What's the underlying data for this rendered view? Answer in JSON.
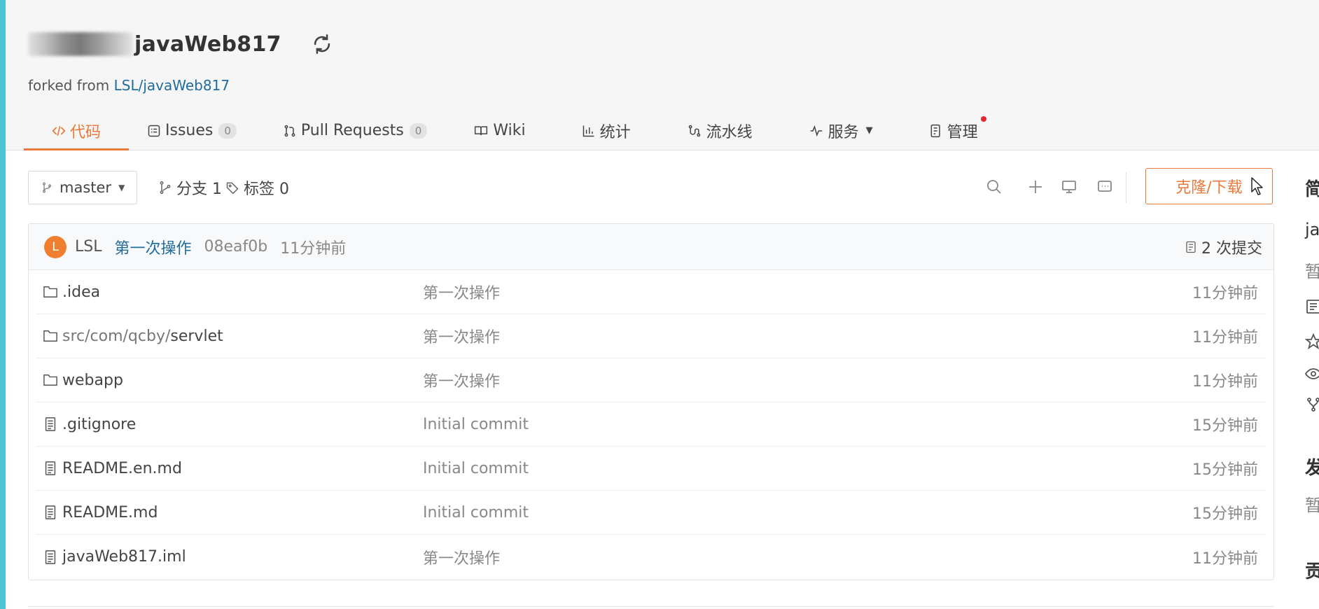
{
  "repo": {
    "name": "javaWeb817",
    "forked_prefix": "forked from ",
    "forked_link": "LSL/javaWeb817"
  },
  "tabs": [
    {
      "label": "代码",
      "icon": "code-icon",
      "active": true
    },
    {
      "label": "Issues",
      "icon": "issues-icon",
      "badge": "0"
    },
    {
      "label": "Pull Requests",
      "icon": "pull-request-icon",
      "badge": "0"
    },
    {
      "label": "Wiki",
      "icon": "wiki-icon"
    },
    {
      "label": "统计",
      "icon": "stats-icon"
    },
    {
      "label": "流水线",
      "icon": "pipeline-icon"
    },
    {
      "label": "服务",
      "icon": "service-icon"
    },
    {
      "label": "管理",
      "icon": "manage-icon"
    }
  ],
  "toolbar": {
    "branch": "master",
    "branches": "分支 1",
    "tags": "标签 0",
    "clone_label": "克隆/下载"
  },
  "last_commit": {
    "avatar_letter": "L",
    "author": "LSL",
    "message": "第一次操作",
    "sha": "08eaf0b",
    "time": "11分钟前",
    "commits_count": "2 次提交"
  },
  "files": [
    {
      "type": "folder",
      "name": ".idea",
      "message": "第一次操作",
      "time": "11分钟前"
    },
    {
      "type": "folder",
      "path": "src/com/qcby/",
      "name": "servlet",
      "message": "第一次操作",
      "time": "11分钟前"
    },
    {
      "type": "folder",
      "name": "webapp",
      "message": "第一次操作",
      "time": "11分钟前"
    },
    {
      "type": "file",
      "name": ".gitignore",
      "message": "Initial commit",
      "time": "15分钟前"
    },
    {
      "type": "file",
      "name": "README.en.md",
      "message": "Initial commit",
      "time": "15分钟前"
    },
    {
      "type": "file",
      "name": "README.md",
      "message": "Initial commit",
      "time": "15分钟前"
    },
    {
      "type": "file",
      "name": "javaWeb817.iml",
      "message": "第一次操作",
      "time": "11分钟前"
    }
  ],
  "sidebar": {
    "h1": "简",
    "t1": "ja",
    "t2": "暂",
    "h2": "发",
    "t3": "暂",
    "h3": "贡"
  },
  "colors": {
    "accent": "#e8793b",
    "link": "#1f6c9c",
    "avatar": "#ef7f2f",
    "strip": "#4fc3cf"
  }
}
